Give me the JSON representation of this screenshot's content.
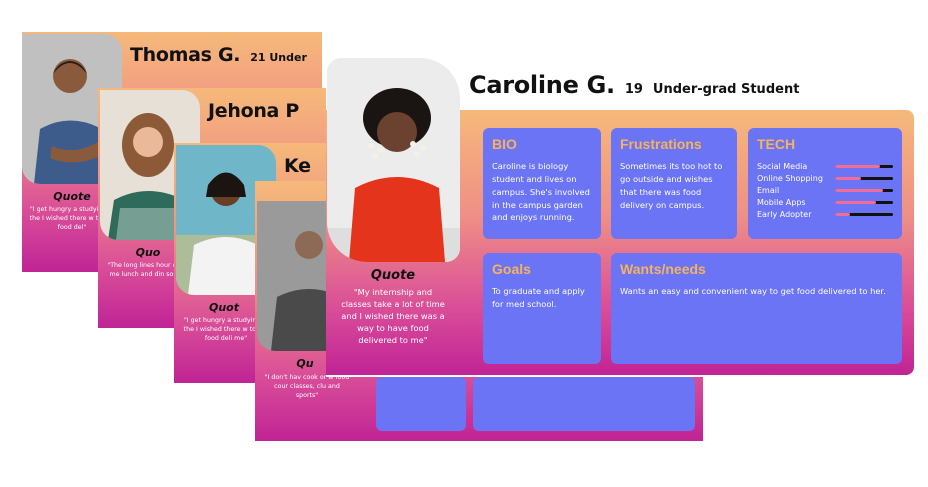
{
  "cards": [
    {
      "name": "Thomas G.",
      "meta": "21 Under",
      "quote_title": "Quote",
      "quote_body": "\"I get hungry a studying in the I wished there w to get food del\""
    },
    {
      "name": "Jehona P",
      "meta": "",
      "quote_title": "Quo",
      "quote_body": "\"The long lines hour deters me lunch and din someti\""
    },
    {
      "name": "Ke",
      "meta": "",
      "quote_title": "Quot",
      "quote_body": "\"I get hungry a studying in the I wished there w to get food deli me\""
    },
    {
      "name": "",
      "meta": "",
      "quote_title": "Qu",
      "quote_body": "\"I don't hav cook or w food cour classes, clu and sports\""
    }
  ],
  "main": {
    "name": "Caroline G.",
    "age": "19",
    "role": "Under-grad Student",
    "quote_title": "Quote",
    "quote_body": "\"My internship and classes take a lot of time and I wished there was a way to have food delivered to me\"",
    "bio_title": "BIO",
    "bio_text": "Caroline is biology student and lives on campus. She's involved in the campus garden and enjoys running.",
    "frustrations_title": "Frustrations",
    "frustrations_text": "Sometimes its too hot to go outside and wishes that there was food delivery on campus.",
    "tech_title": "TECH",
    "tech": [
      {
        "label": "Social Media",
        "level": 0.78
      },
      {
        "label": "Online Shopping",
        "level": 0.45
      },
      {
        "label": "Email",
        "level": 0.82
      },
      {
        "label": "Mobile Apps",
        "level": 0.7
      },
      {
        "label": "Early Adopter",
        "level": 0.25
      }
    ],
    "goals_title": "Goals",
    "goals_text": "To graduate and apply for med school.",
    "wants_title": "Wants/needs",
    "wants_text": "Wants an easy and convenient way to get food delivered to her."
  },
  "colors": {
    "box": "#6b74f4",
    "heading": "#f7b35b",
    "bar_fill": "#f06d95",
    "bar_track": "#111111"
  }
}
